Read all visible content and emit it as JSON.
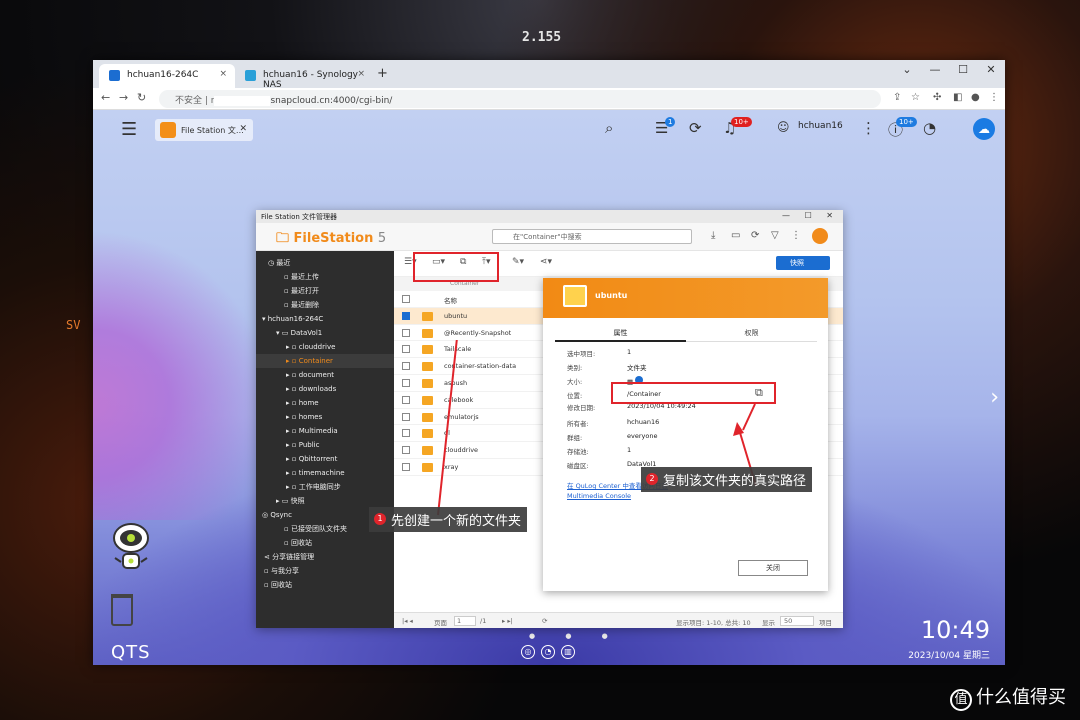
{
  "browser": {
    "tabs": [
      {
        "label": "hchuan16-264C",
        "close": "×"
      },
      {
        "label": "hchuan16 - Synology NAS",
        "close": "×"
      }
    ],
    "new_tab": "+",
    "window_controls": [
      "⌄",
      "—",
      "☐",
      "✕"
    ],
    "url_security": "不安全 | r",
    "url_text": "snapcloud.cn:4000/cgi-bin/"
  },
  "qts": {
    "app_tab_label": "File Station 文…",
    "user": "hchuan16",
    "badges": {
      "tasks": "1",
      "notifications": "10+",
      "updates": "10+"
    },
    "clock": "10:49",
    "date": "2023/10/04 星期三",
    "logo": "QTS"
  },
  "filestation": {
    "window_title": "File Station 文件管理器",
    "app_name": "FileStation",
    "app_version": "5",
    "search_placeholder": "在\"Container\"中搜索",
    "quick_button": "快照",
    "breadcrumb": "Container",
    "column_name": "名称",
    "sidebar": [
      {
        "label": "最近",
        "indent": 0
      },
      {
        "label": "最近上传",
        "indent": 2
      },
      {
        "label": "最近打开",
        "indent": 2
      },
      {
        "label": "最近删除",
        "indent": 2
      },
      {
        "label": "hchuan16-264C",
        "indent": 0
      },
      {
        "label": "DataVol1",
        "indent": 1
      },
      {
        "label": "clouddrive",
        "indent": 2
      },
      {
        "label": "Container",
        "indent": 2
      },
      {
        "label": "document",
        "indent": 2
      },
      {
        "label": "downloads",
        "indent": 2
      },
      {
        "label": "home",
        "indent": 2
      },
      {
        "label": "homes",
        "indent": 2
      },
      {
        "label": "Multimedia",
        "indent": 2
      },
      {
        "label": "Public",
        "indent": 2
      },
      {
        "label": "Qbittorrent",
        "indent": 2
      },
      {
        "label": "timemachine",
        "indent": 2
      },
      {
        "label": "工作电脑同步",
        "indent": 2
      },
      {
        "label": "快照",
        "indent": 1
      },
      {
        "label": "Qsync",
        "indent": 0
      },
      {
        "label": "已接受团队文件夹",
        "indent": 1
      },
      {
        "label": "回收站",
        "indent": 1
      },
      {
        "label": "分享链接管理",
        "indent": 0
      },
      {
        "label": "与我分享",
        "indent": 0
      },
      {
        "label": "回收站",
        "indent": 0
      }
    ],
    "files": [
      "ubuntu",
      "@Recently-Snapshot",
      "Tailscale",
      "container-station-data",
      "aspush",
      "calebook",
      "emulatorjs",
      "ql",
      "clouddrive",
      "xray"
    ],
    "footer": {
      "page_label": "页面",
      "page": "1",
      "page_total": "/1",
      "display_info": "显示项目: 1-10, 总共: 10",
      "display_label": "显示",
      "per_page": "50",
      "items": "项目"
    }
  },
  "properties": {
    "title": "ubuntu",
    "tab_attributes": "属性",
    "tab_permissions": "权限",
    "fields": [
      {
        "k": "选中项目:",
        "v": "1"
      },
      {
        "k": "类别:",
        "v": "文件夹"
      },
      {
        "k": "大小:",
        "v": ""
      },
      {
        "k": "位置:",
        "v": "/Container"
      },
      {
        "k": "修改日期:",
        "v": "2023/10/04 10:49:24"
      },
      {
        "k": "所有者:",
        "v": "hchuan16"
      },
      {
        "k": "群组:",
        "v": "everyone"
      },
      {
        "k": "存储池:",
        "v": "1"
      },
      {
        "k": "磁盘区:",
        "v": "DataVol1"
      }
    ],
    "link1": "在 QuLog Center 中查看访问日志",
    "link2": "Multimedia Console",
    "close_button": "关闭"
  },
  "annotations": {
    "note1_num": "1",
    "note1": "先创建一个新的文件夹",
    "note2_num": "2",
    "note2": "复制该文件夹的真实路径"
  },
  "watermark": {
    "icon": "值",
    "text": "什么值得买"
  },
  "background": {
    "number": "2.155"
  },
  "colors": {
    "accent": "#f18b1b",
    "annotation": "#e0242b",
    "link": "#1b5fd1"
  }
}
